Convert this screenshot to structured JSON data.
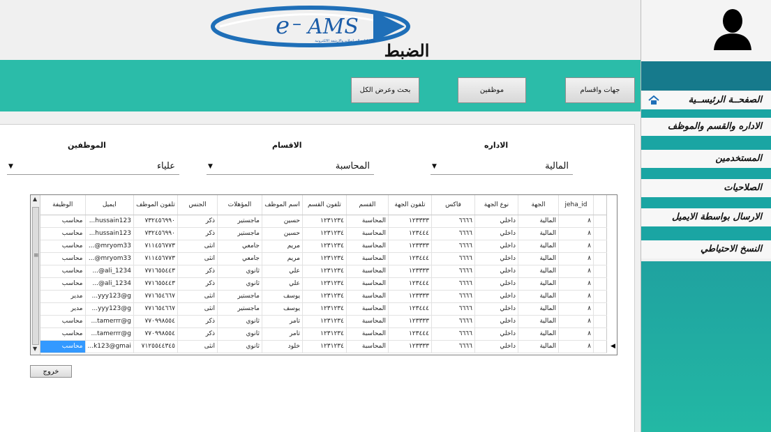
{
  "header": {
    "logo_text": "e-AMS",
    "logo_subtitle": "نظام ادارة المراسلات والارشفة الالكترونية",
    "page_title": "الضبط"
  },
  "toolbar": {
    "departments_btn": "جهات واقسام",
    "employees_btn": "موظفين",
    "search_all_btn": "بحث وعرض الكل"
  },
  "filters": {
    "admin_label": "الاداره",
    "admin_value": "المالية",
    "sections_label": "الاقسام",
    "sections_value": "المحاسبة",
    "employee_label": "الموظفين",
    "employee_value": "علياء"
  },
  "grid": {
    "columns": [
      "jeha_id",
      "الجهة",
      "نوع الجهة",
      "فاكس",
      "تلفون الجهة",
      "القسم",
      "تلفون القسم",
      "اسم الموظف",
      "المؤهلات",
      "الجنس",
      "تلفون الموظف",
      "ايميل",
      "الوظيفة"
    ],
    "rows": [
      [
        "٨",
        "المالية",
        "داخلي",
        "٦٦٦٦",
        "١٢٣٣٣٣",
        "المحاسبة",
        "١٢٣١٢٣٤",
        "حسين",
        "ماجستير",
        "ذكر",
        "٧٣٢٤٥٦٩٩٠",
        "...hussain123",
        "محاسب"
      ],
      [
        "٨",
        "المالية",
        "داخلي",
        "٦٦٦٦",
        "١٢٣٤٤٤",
        "المحاسبة",
        "١٢٣١٢٣٤",
        "حسين",
        "ماجستير",
        "ذكر",
        "٧٣٢٤٥٦٩٩٠",
        "...hussain123",
        "محاسب"
      ],
      [
        "٨",
        "المالية",
        "داخلي",
        "٦٦٦٦",
        "١٢٣٣٣٣",
        "المحاسبة",
        "١٢٣١٢٣٤",
        "مريم",
        "جامعي",
        "انثى",
        "٧١١٤٥٦٧٧٣",
        "...@mryom33",
        "محاسب"
      ],
      [
        "٨",
        "المالية",
        "داخلي",
        "٦٦٦٦",
        "١٢٣٤٤٤",
        "المحاسبة",
        "١٢٣١٢٣٤",
        "مريم",
        "جامعي",
        "انثى",
        "٧١١٤٥٦٧٧٣",
        "...@mryom33",
        "محاسب"
      ],
      [
        "٨",
        "المالية",
        "داخلي",
        "٦٦٦٦",
        "١٢٣٣٣٣",
        "المحاسبة",
        "١٢٣١٢٣٤",
        "علي",
        "ثانوي",
        "ذكر",
        "٧٧١٦٥٥٤٤٣",
        "...@ali_1234",
        "محاسب"
      ],
      [
        "٨",
        "المالية",
        "داخلي",
        "٦٦٦٦",
        "١٢٣٤٤٤",
        "المحاسبة",
        "١٢٣١٢٣٤",
        "علي",
        "ثانوي",
        "ذكر",
        "٧٧١٦٥٥٤٤٣",
        "...@ali_1234",
        "محاسب"
      ],
      [
        "٨",
        "المالية",
        "داخلي",
        "٦٦٦٦",
        "١٢٣٣٣٣",
        "المحاسبة",
        "١٢٣١٢٣٤",
        "يوسف",
        "ماجستير",
        "انثى",
        "٧٧١٦٥٤٦٦٧",
        "...yyy123@g",
        "مدير"
      ],
      [
        "٨",
        "المالية",
        "داخلي",
        "٦٦٦٦",
        "١٢٣٤٤٤",
        "المحاسبة",
        "١٢٣١٢٣٤",
        "يوسف",
        "ماجستير",
        "انثى",
        "٧٧١٦٥٤٦٦٧",
        "...yyy123@g",
        "مدير"
      ],
      [
        "٨",
        "المالية",
        "داخلي",
        "٦٦٦٦",
        "١٢٣٣٣٣",
        "المحاسبة",
        "١٢٣١٢٣٤",
        "تامر",
        "ثانوي",
        "ذكر",
        "٧٧٠٩٩٨٥٥٤",
        "...tamerrr@g",
        "محاسب"
      ],
      [
        "٨",
        "المالية",
        "داخلي",
        "٦٦٦٦",
        "١٢٣٤٤٤",
        "المحاسبة",
        "١٢٣١٢٣٤",
        "تامر",
        "ثانوي",
        "ذكر",
        "٧٧٠٩٩٨٥٥٤",
        "...tamerrr@g",
        "محاسب"
      ],
      [
        "٨",
        "المالية",
        "داخلي",
        "٦٦٦٦",
        "١٢٣٣٣٣",
        "المحاسبة",
        "١٢٣١٢٣٤",
        "خلود",
        "ثانوي",
        "انثى",
        "٧١٢٥٥٤٤٣٤٥",
        "...k123@gmai",
        "محاسب"
      ]
    ],
    "selected_row": 10,
    "selected_col": 12
  },
  "exit_btn": "خروج",
  "sidebar": {
    "items": [
      {
        "label": "الصفحــة الرئيســية"
      },
      {
        "label": "الاداره والقسم والموظف"
      },
      {
        "label": "المستخدمين"
      },
      {
        "label": "الصلاحيات"
      },
      {
        "label": "الارسال بواسطة الايميل"
      },
      {
        "label": "النسخ الاحتياطي"
      }
    ]
  },
  "colors": {
    "teal": "#2bbca9",
    "dark_teal": "#167a8c",
    "selection": "#3399ff"
  }
}
